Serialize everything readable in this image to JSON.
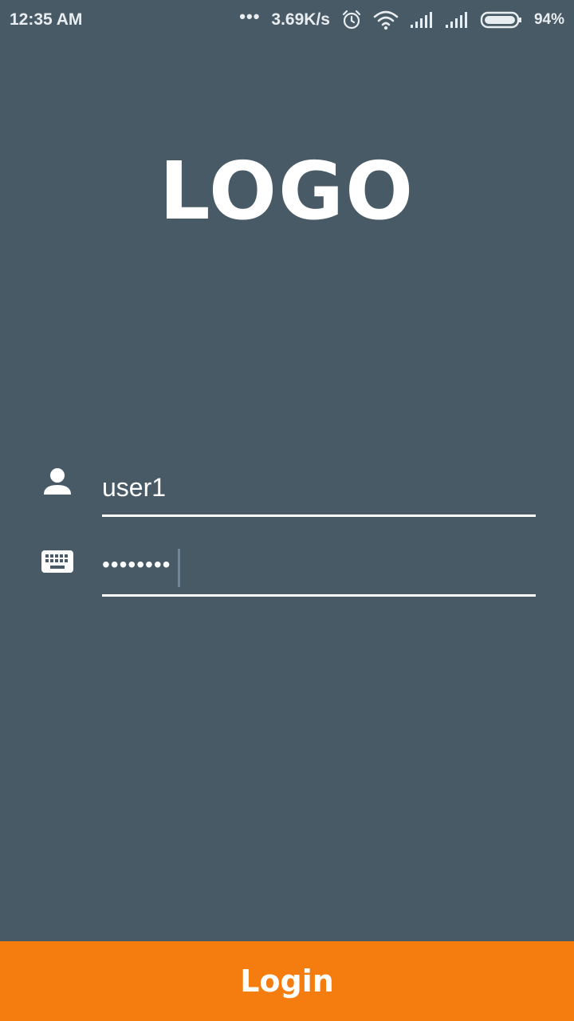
{
  "status_bar": {
    "time": "12:35 AM",
    "dots": "•••",
    "network_speed": "3.69K/s",
    "battery_percent": "94%"
  },
  "logo": {
    "text": "LOGO"
  },
  "form": {
    "username": {
      "value": "user1",
      "icon": "person-icon"
    },
    "password": {
      "masked_value": "••••••••",
      "icon": "keyboard-icon"
    }
  },
  "login_button": {
    "label": "Login"
  },
  "colors": {
    "background": "#475a66",
    "accent": "#f57c0e",
    "text": "#ffffff"
  }
}
